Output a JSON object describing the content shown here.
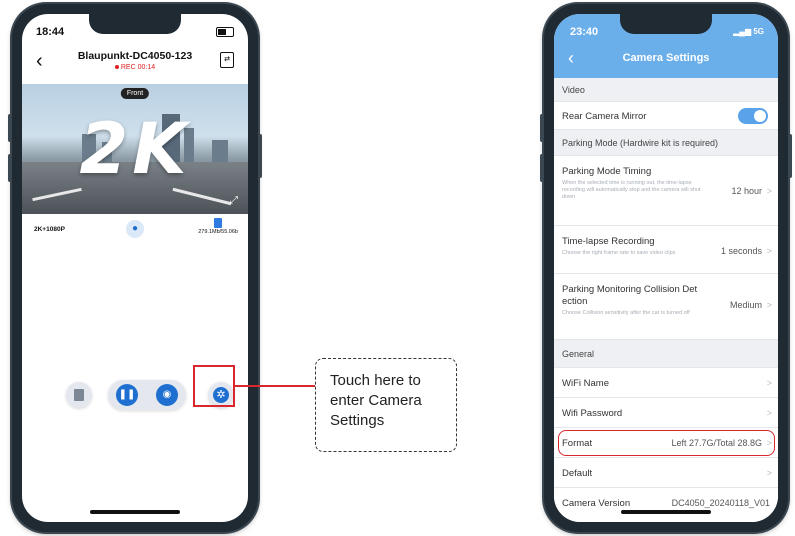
{
  "left_phone": {
    "time": "18:44",
    "title": "Blaupunkt-DC4050-123",
    "rec_status": "REC 00:14",
    "camera_tag": "Front",
    "overlay_text": "2K",
    "resolution": "2K+1080P",
    "storage": "279.1Mb/55.06b",
    "icons": {
      "back": "chevron-left-icon",
      "camera_switch": "camera-switch-icon",
      "fullscreen": "fullscreen-icon",
      "mic": "microphone-icon",
      "sd": "sd-card-icon",
      "gallery": "gallery-icon",
      "pause": "pause-icon",
      "photo": "camera-icon",
      "settings": "gear-icon"
    }
  },
  "callout": {
    "text_lines": [
      "Touch here to",
      "enter Camera",
      "Settings"
    ]
  },
  "right_phone": {
    "time": "23:40",
    "signal": "5G",
    "title": "Camera Settings",
    "sections": {
      "video": "Video",
      "parking": "Parking Mode (Hardwire kit is required)",
      "general": "General"
    },
    "rows": {
      "rear_mirror": "Rear Camera Mirror",
      "parking_timing": {
        "label": "Parking Mode Timing",
        "sub": "When the selected time is running out, the time-lapse recording will automatically stop and the camera will shut down",
        "value": "12 hour"
      },
      "timelapse": {
        "label": "Time-lapse Recording",
        "sub": "Choose the right frame rate to save video clips",
        "value": "1 seconds"
      },
      "collision": {
        "label_line1": "Parking Monitoring Collision Det",
        "label_line2": "ection",
        "sub": "Choose Collision sensitivity after the car is turned off",
        "value": "Medium"
      },
      "wifi_name": "WiFi Name",
      "wifi_password": "Wifi Password",
      "format": {
        "label": "Format",
        "value": "Left 27.7G/Total 28.8G"
      },
      "default": "Default",
      "camera_version": {
        "label": "Camera Version",
        "value": "DC4050_20240118_V01"
      }
    },
    "chevron": ">"
  },
  "colors": {
    "accent_blue": "#1f6fd0",
    "header_blue": "#6aaeea",
    "highlight_red": "#d9272e"
  }
}
